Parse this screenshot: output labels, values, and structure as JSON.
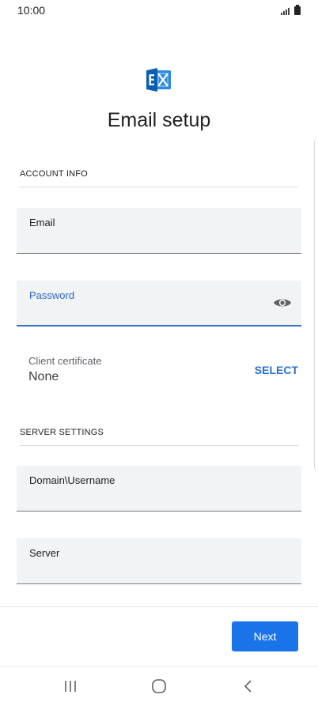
{
  "status_bar": {
    "time": "10:00"
  },
  "header": {
    "title": "Email setup"
  },
  "account_info": {
    "section_title": "ACCOUNT INFO",
    "email": {
      "label": "Email",
      "value": ""
    },
    "password": {
      "label": "Password",
      "value": ""
    },
    "client_certificate": {
      "label": "Client certificate",
      "value": "None",
      "action": "SELECT"
    }
  },
  "server_settings": {
    "section_title": "SERVER SETTINGS",
    "domain_username": {
      "label": "Domain\\Username",
      "value": ""
    },
    "server": {
      "label": "Server",
      "value": ""
    }
  },
  "footer": {
    "next_label": "Next"
  },
  "nav_bar": {
    "recents": "recents-icon",
    "home": "home-icon",
    "back": "back-icon"
  },
  "colors": {
    "accent": "#1a73e8",
    "focus": "#2d67c7",
    "field_bg": "#f1f3f4",
    "logo": "#0a6ac4"
  }
}
